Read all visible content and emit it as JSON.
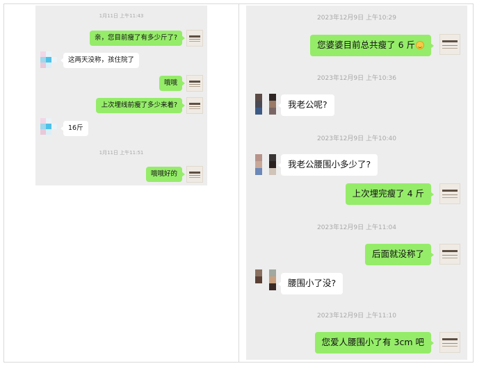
{
  "left_chat": {
    "timestamps": [
      "1月11日 上午11:43",
      "1月11日 上午11:51"
    ],
    "messages": [
      {
        "side": "out",
        "text": "亲，您目前瘦了有多少斤了?"
      },
      {
        "side": "in",
        "text": "这两天没称，孩住院了"
      },
      {
        "side": "out",
        "text": "哦哦"
      },
      {
        "side": "out",
        "text": "上次埋线前瘦了多少来着?"
      },
      {
        "side": "in",
        "text": "16斤"
      },
      {
        "side": "out",
        "text": "哦哦好的"
      }
    ]
  },
  "right_chat": {
    "timestamps": [
      "2023年12月9日 上午10:29",
      "2023年12月9日 上午10:36",
      "2023年12月9日 上午10:40",
      "2023年12月9日 上午11:04",
      "2023年12月9日 上午11:10"
    ],
    "messages": [
      {
        "side": "out",
        "text": "您婆婆目前总共瘦了 6 斤",
        "emoji": "smile-emoji"
      },
      {
        "side": "in",
        "text": "我老公呢?"
      },
      {
        "side": "in",
        "text": "我老公腰围小多少了?"
      },
      {
        "side": "out",
        "text": "上次埋完瘦了 4 斤"
      },
      {
        "side": "out",
        "text": "后面就没称了"
      },
      {
        "side": "in",
        "text": "腰围小了没?"
      },
      {
        "side": "out",
        "text": "您爱人腰围小了有 3cm 吧"
      }
    ]
  },
  "colors": {
    "chat_bg": "#ededed",
    "outgoing_bubble": "#95ec69",
    "incoming_bubble": "#ffffff",
    "timestamp": "#a8a8a8"
  },
  "icons": [
    "self-avatar-logo",
    "contact-avatar-mosaic",
    "smile-emoji"
  ]
}
